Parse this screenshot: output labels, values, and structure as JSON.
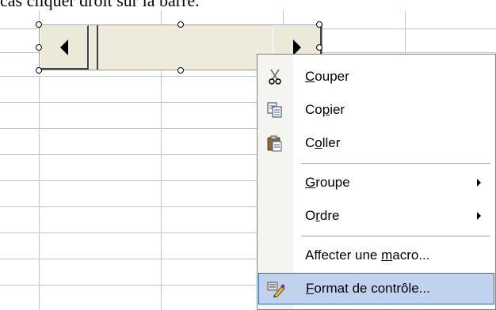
{
  "caption": {
    "text": "cas cliquer droit sur la barre."
  },
  "scrollbar": {
    "left_arrow_icon": "arrow-left-icon",
    "right_arrow_icon": "arrow-right-icon"
  },
  "context_menu": {
    "items": [
      {
        "pre": "",
        "key": "C",
        "post": "ouper",
        "icon": "scissors-icon",
        "submenu": false,
        "selected": false
      },
      {
        "pre": "Co",
        "key": "p",
        "post": "ier",
        "icon": "copy-icon",
        "submenu": false,
        "selected": false
      },
      {
        "pre": "C",
        "key": "o",
        "post": "ller",
        "icon": "paste-icon",
        "submenu": false,
        "selected": false
      },
      {
        "pre": "",
        "key": "G",
        "post": "roupe",
        "icon": "",
        "submenu": true,
        "selected": false
      },
      {
        "pre": "O",
        "key": "r",
        "post": "dre",
        "icon": "",
        "submenu": true,
        "selected": false
      },
      {
        "pre": "Affecter une ",
        "key": "m",
        "post": "acro...",
        "icon": "",
        "submenu": false,
        "selected": false
      },
      {
        "pre": "",
        "key": "F",
        "post": "ormat de contrôle...",
        "icon": "format-control-icon",
        "submenu": false,
        "selected": true
      }
    ]
  },
  "colors": {
    "selection_bg": "#c1d2ee",
    "selection_border": "#316ac5",
    "control_face": "#ece9d8",
    "grid_line": "#c4c4c4"
  }
}
